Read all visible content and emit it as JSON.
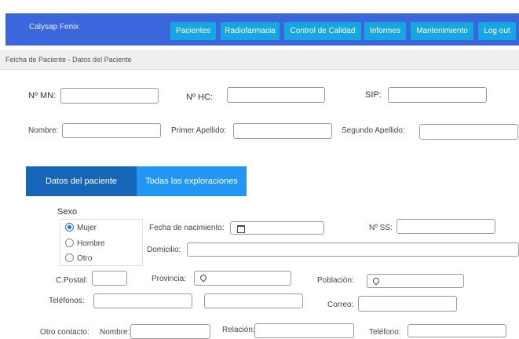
{
  "navbar": {
    "brand": "Calysap Fenix",
    "items": [
      "Pacientes",
      "Radiofarmacia",
      "Control de Calidad",
      "Informes",
      "Mantenimiento",
      "Log out"
    ]
  },
  "breadcrumb": "Feicha de Paciente - Datos del Paciente",
  "ids": {
    "mn_label": "Nº MN:",
    "hc_label": "Nº HC:",
    "sip_label": "SIP:"
  },
  "names": {
    "nombre_label": "Nombre:",
    "primer_label": "Primer Apellido:",
    "segundo_label": "Segundo Apellido:"
  },
  "tabs": {
    "datos": "Datos del paciente",
    "exploraciones": "Todas las exploraciones"
  },
  "sexo": {
    "title": "Sexo",
    "options": [
      "Mujer",
      "Hombre",
      "Otro"
    ],
    "selected": "Mujer"
  },
  "details": {
    "fecha_label": "Fecha de nacimiento:",
    "ss_label": "Nº SS:",
    "domicilio_label": "Domicilio:",
    "cpostal_label": "C.Postal:",
    "provincia_label": "Provincia:",
    "poblacion_label": "Población:",
    "telefonos_label": "Teléfonos:",
    "correo_label": "Correo:"
  },
  "contacto": {
    "label": "Otro contacto:",
    "nombre_label": "Nombre:",
    "relacion_label": "Relación:",
    "telefono_label": "Teléfono:"
  },
  "colors": {
    "navbar": "#3b66dc",
    "nav_button": "#16a6e2",
    "tab_active": "#1565b8",
    "tab_inactive": "#2196f3"
  }
}
